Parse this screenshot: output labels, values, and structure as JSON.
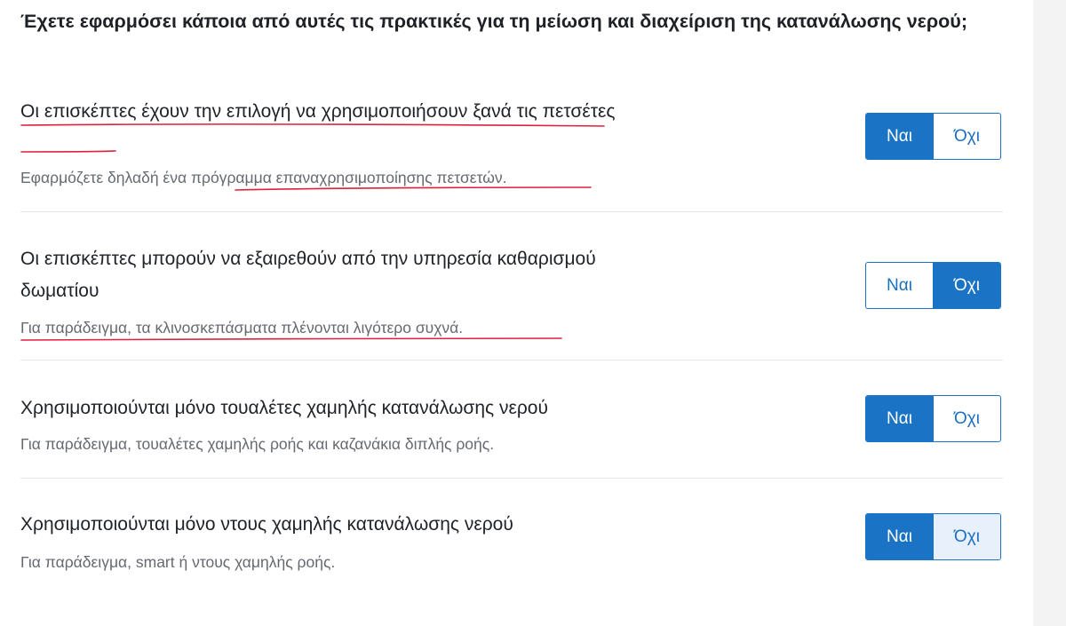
{
  "question": "Έχετε εφαρμόσει κάποια από αυτές τις πρακτικές για τη μείωση και διαχείριση της κατανάλωσης νερού;",
  "practices": [
    {
      "title": "Οι επισκέπτες έχουν την επιλογή να χρησιμοποιήσουν ξανά τις πετσέτες",
      "description": "Εφαρμόζετε δηλαδή ένα πρόγραμμα επαναχρησιμοποίησης πετσετών.",
      "yes_label": "Ναι",
      "no_label": "Όχι",
      "selected": "Ναι"
    },
    {
      "title": "Οι επισκέπτες μπορούν να εξαιρεθούν από την υπηρεσία καθαρισμού δωματίου",
      "description": "Για παράδειγμα, τα κλινοσκεπάσματα πλένονται λιγότερο συχνά.",
      "yes_label": "Ναι",
      "no_label": "Όχι",
      "selected": "Όχι"
    },
    {
      "title": "Χρησιμοποιούνται μόνο τουαλέτες χαμηλής κατανάλωσης νερού",
      "description": "Για παράδειγμα, τουαλέτες χαμηλής ροής και καζανάκια διπλής ροής.",
      "yes_label": "Ναι",
      "no_label": "Όχι",
      "selected": "Ναι"
    },
    {
      "title": "Χρησιμοποιούνται μόνο ντους χαμηλής κατανάλωσης νερού",
      "description": "Για παράδειγμα, smart ή ντους χαμηλής ροής.",
      "yes_label": "Ναι",
      "no_label": "Όχι",
      "selected": "Ναι",
      "hovered": "Όχι"
    }
  ],
  "colors": {
    "accent": "#1a73c4",
    "annotation": "#e0203c",
    "hover": "#e8f1fb"
  }
}
